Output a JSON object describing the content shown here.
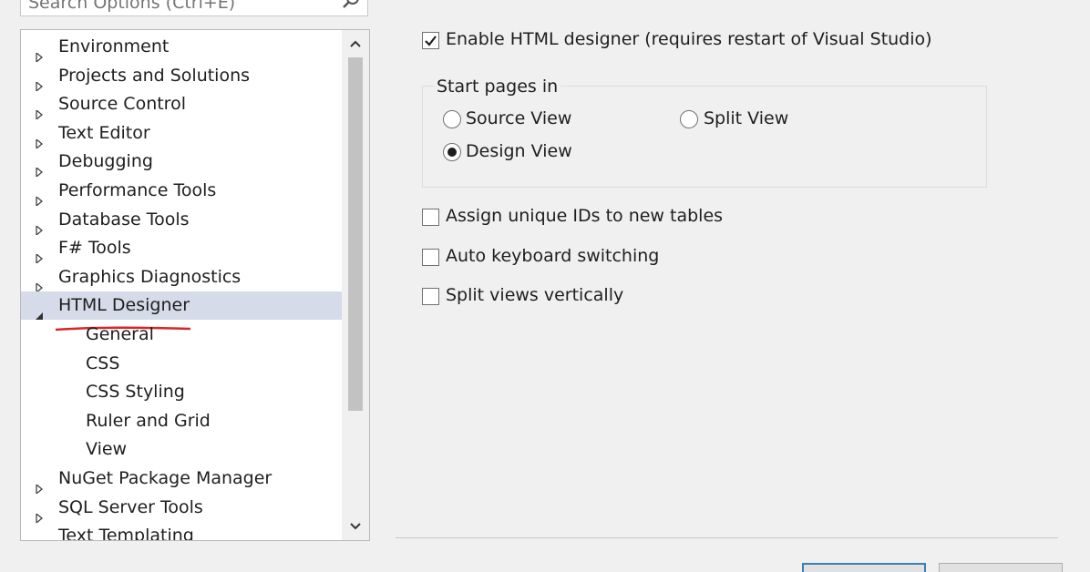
{
  "search": {
    "placeholder": "Search Options (Ctrl+E)"
  },
  "tree": {
    "items": [
      {
        "label": "Environment",
        "expanded": false
      },
      {
        "label": "Projects and Solutions",
        "expanded": false
      },
      {
        "label": "Source Control",
        "expanded": false
      },
      {
        "label": "Text Editor",
        "expanded": false
      },
      {
        "label": "Debugging",
        "expanded": false
      },
      {
        "label": "Performance Tools",
        "expanded": false
      },
      {
        "label": "Database Tools",
        "expanded": false
      },
      {
        "label": "F# Tools",
        "expanded": false
      },
      {
        "label": "Graphics Diagnostics",
        "expanded": false
      },
      {
        "label": "HTML Designer",
        "expanded": true,
        "selected": true
      },
      {
        "label": "General",
        "child": true
      },
      {
        "label": "CSS",
        "child": true
      },
      {
        "label": "CSS Styling",
        "child": true
      },
      {
        "label": "Ruler and Grid",
        "child": true
      },
      {
        "label": "View",
        "child": true
      },
      {
        "label": "NuGet Package Manager",
        "expanded": false
      },
      {
        "label": "SQL Server Tools",
        "expanded": false
      },
      {
        "label": "Text Templating",
        "expanded": false
      }
    ]
  },
  "options": {
    "enable_designer": {
      "label": "Enable HTML designer (requires restart of Visual Studio)",
      "checked": true
    },
    "start_pages": {
      "title": "Start pages in",
      "source_view": {
        "label": "Source View",
        "selected": false
      },
      "split_view": {
        "label": "Split View",
        "selected": false
      },
      "design_view": {
        "label": "Design View",
        "selected": true
      }
    },
    "assign_ids": {
      "label": "Assign unique IDs to new tables",
      "checked": false
    },
    "auto_keyboard": {
      "label": "Auto keyboard switching",
      "checked": false
    },
    "split_vertically": {
      "label": "Split views vertically",
      "checked": false
    }
  },
  "colors": {
    "selection": "#d6dbe9",
    "annotation_underline": "#d9262b"
  }
}
